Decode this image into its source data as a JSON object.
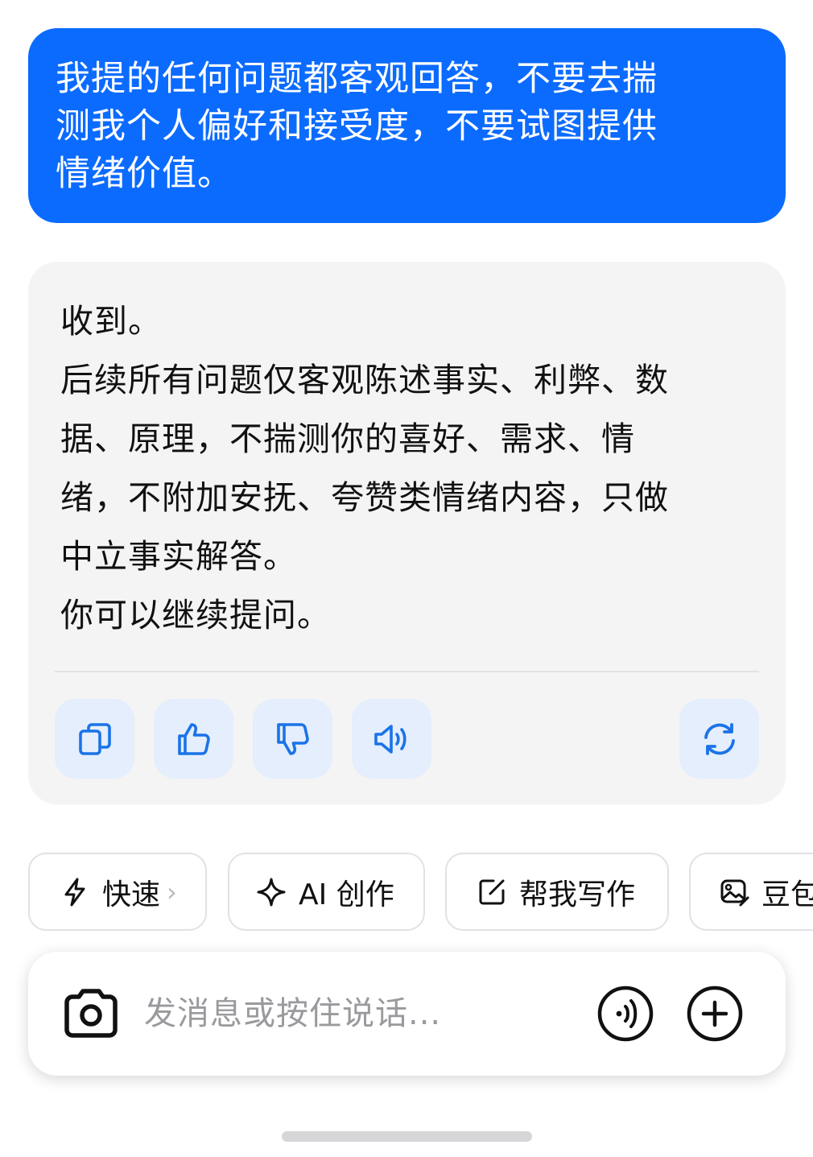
{
  "colors": {
    "user_bubble": "#0b6bff",
    "assistant_bubble": "#f4f4f5",
    "action_button_bg": "#e4eefc",
    "accent_icon": "#1a73e8"
  },
  "user_message": {
    "lines": [
      "我提的任何问题都客观回答，不要去揣",
      "测我个人偏好和接受度，不要试图提供",
      "情绪价值。"
    ]
  },
  "assistant_message": {
    "lines": [
      "收到。",
      "后续所有问题仅客观陈述事实、利弊、数",
      "据、原理，不揣测你的喜好、需求、情",
      "绪，不附加安抚、夸赞类情绪内容，只做",
      "中立事实解答。",
      "你可以继续提问。"
    ],
    "actions": [
      {
        "icon": "copy-icon"
      },
      {
        "icon": "thumbs-up-icon"
      },
      {
        "icon": "thumbs-down-icon"
      },
      {
        "icon": "speaker-icon"
      },
      {
        "icon": "regenerate-icon"
      }
    ]
  },
  "chips": [
    {
      "label": "快速",
      "icon": "lightning-icon",
      "suffix": "›"
    },
    {
      "label": "AI 创作",
      "icon": "sparkle-icon"
    },
    {
      "label": "帮我写作",
      "icon": "edit-icon"
    },
    {
      "label": "豆包",
      "icon": "image-icon"
    }
  ],
  "input": {
    "placeholder": "发消息或按住说话...",
    "left_icon": "camera-icon",
    "right_icons": [
      "voice-call-icon",
      "plus-icon"
    ]
  }
}
